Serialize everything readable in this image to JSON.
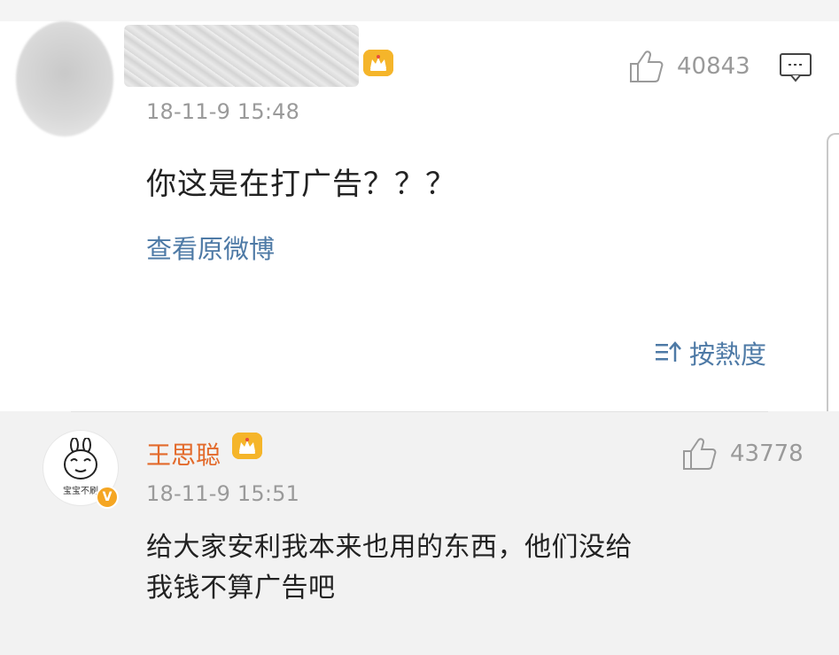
{
  "main_comment": {
    "timestamp": "18-11-9 15:48",
    "likes": "40843",
    "text": "你这是在打广告？？？",
    "view_original": "查看原微博",
    "sort_label": "按熱度"
  },
  "reply": {
    "username": "王思聪",
    "timestamp": "18-11-9 15:51",
    "likes": "43778",
    "text_line1": "给大家安利我本来也用的东西，他们没给",
    "text_line2": "我钱不算广告吧",
    "avatar_caption": "宝宝不刷"
  },
  "icons": {
    "like": "thumbs-up-icon",
    "comment": "comment-icon",
    "crown": "crown-icon",
    "sort": "sort-icon",
    "verified": "verified-badge-icon"
  },
  "colors": {
    "link_blue": "#4e7aa6",
    "username_orange": "#e36a2b",
    "muted_gray": "#9a9a9a",
    "crown_gold": "#f5b52a"
  }
}
